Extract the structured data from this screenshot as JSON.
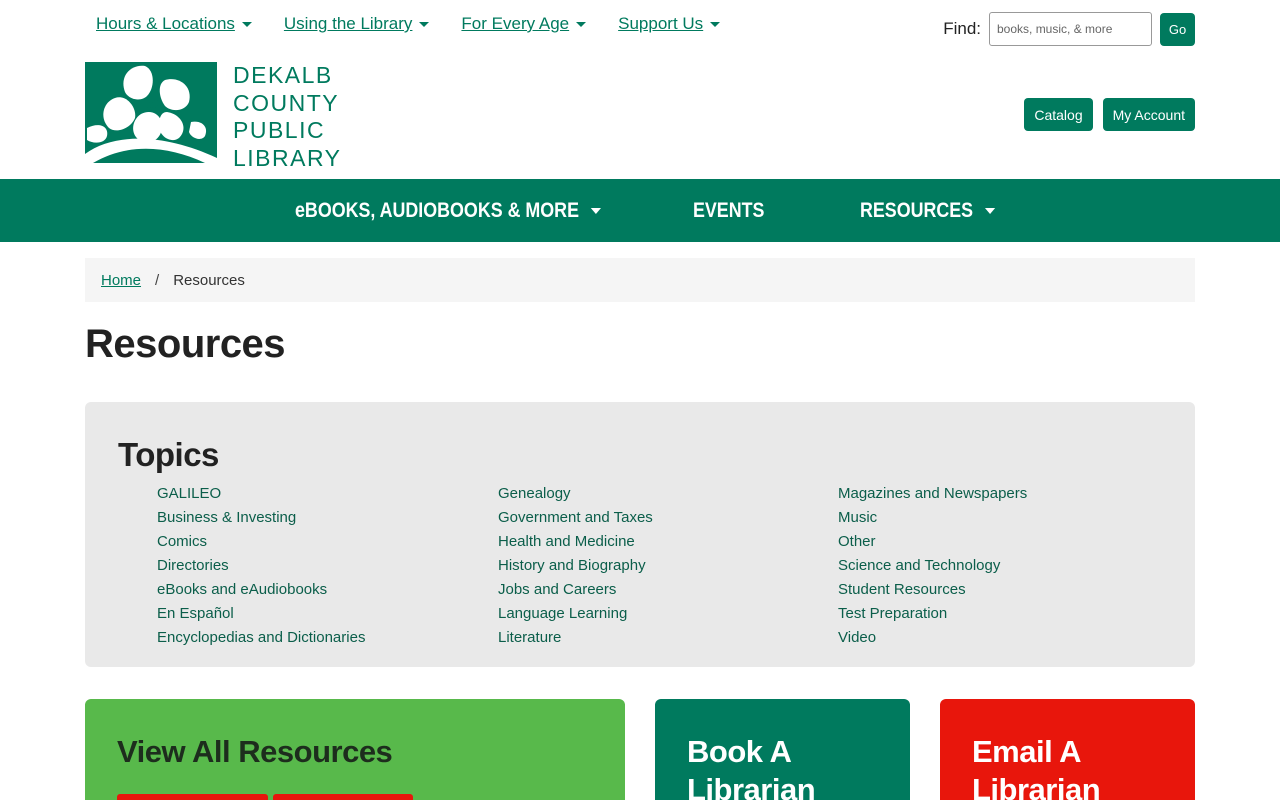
{
  "topnav": [
    {
      "label": "Hours & Locations"
    },
    {
      "label": "Using the Library"
    },
    {
      "label": "For Every Age"
    },
    {
      "label": "Support Us"
    }
  ],
  "search": {
    "label": "Find:",
    "placeholder": "books, music, & more",
    "go": "Go"
  },
  "logo": {
    "lines": [
      "DEKALB",
      "COUNTY",
      "PUBLIC",
      "LIBRARY"
    ]
  },
  "account": {
    "catalog": "Catalog",
    "my_account": "My Account"
  },
  "mainnav": [
    {
      "label": "eBOOKS, AUDIOBOOKS & MORE"
    },
    {
      "label": "EVENTS"
    },
    {
      "label": "RESOURCES"
    }
  ],
  "breadcrumb": {
    "home": "Home",
    "sep": "/",
    "current": "Resources"
  },
  "page_title": "Resources",
  "topics": {
    "heading": "Topics",
    "col1": [
      "GALILEO",
      "Business & Investing",
      "Comics",
      "Directories",
      "eBooks and eAudiobooks",
      "En Español",
      "Encyclopedias and Dictionaries"
    ],
    "col2": [
      "Genealogy",
      "Government and Taxes",
      "Health and Medicine",
      "History and Biography",
      "Jobs and Careers",
      "Language Learning",
      "Literature"
    ],
    "col3": [
      "Magazines and Newspapers",
      "Music",
      "Other",
      "Science and Technology",
      "Student Resources",
      "Test Preparation",
      "Video"
    ]
  },
  "cards": {
    "view_all": "View All Resources",
    "book_line1": "Book A",
    "book_line2": "Librarian",
    "email_line1": "Email A",
    "email_line2": "Librarian"
  },
  "colors": {
    "brand_green": "#007a5e",
    "light_green": "#58b94b",
    "red": "#e8160c"
  }
}
